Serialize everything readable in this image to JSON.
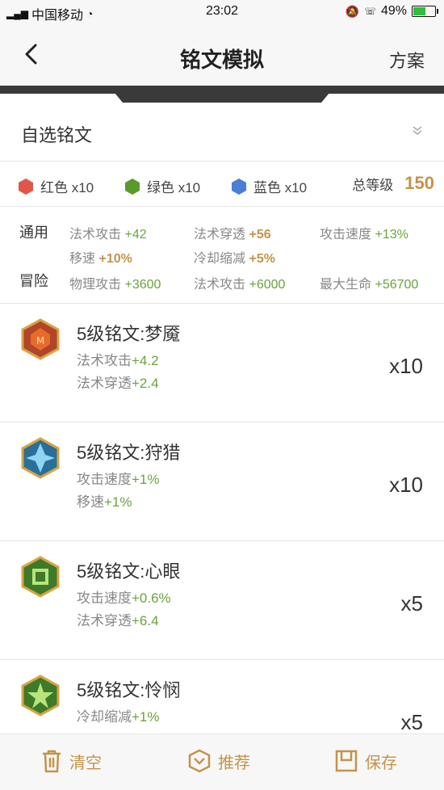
{
  "status": {
    "carrier": "中国移动",
    "time": "23:02",
    "battery": "49%"
  },
  "nav": {
    "title": "铭文模拟",
    "right_label": "方案"
  },
  "selector": {
    "label": "自选铭文"
  },
  "colors": {
    "red": {
      "label": "红色 x10",
      "color": "#e0574a"
    },
    "green": {
      "label": "绿色 x10",
      "color": "#5a9a2d"
    },
    "blue": {
      "label": "蓝色 x10",
      "color": "#4a7fd4"
    },
    "level_label": "总等级",
    "level_value": "150"
  },
  "stats": {
    "general_label": "通用",
    "adventure_label": "冒险",
    "general": [
      {
        "name": "法术攻击",
        "value": "+42"
      },
      {
        "name": "法术穿透",
        "value": "+56"
      },
      {
        "name": "攻击速度",
        "value": "+13%"
      },
      {
        "name": "移速",
        "value": "+10%"
      },
      {
        "name": "冷却缩减",
        "value": "+5%"
      }
    ],
    "adventure": [
      {
        "name": "物理攻击",
        "value": "+3600"
      },
      {
        "name": "法术攻击",
        "value": "+6000"
      },
      {
        "name": "最大生命",
        "value": "+56700"
      }
    ]
  },
  "runes": [
    {
      "name": "5级铭文:梦魇",
      "s1_name": "法术攻击",
      "s1_val": "+4.2",
      "s2_name": "法术穿透",
      "s2_val": "+2.4",
      "count": "x10",
      "icon": "red-rune-icon"
    },
    {
      "name": "5级铭文:狩猎",
      "s1_name": "攻击速度",
      "s1_val": "+1%",
      "s2_name": "移速",
      "s2_val": "+1%",
      "count": "x10",
      "icon": "blue-rune-icon"
    },
    {
      "name": "5级铭文:心眼",
      "s1_name": "攻击速度",
      "s1_val": "+0.6%",
      "s2_name": "法术穿透",
      "s2_val": "+6.4",
      "count": "x5",
      "icon": "green-rune-icon"
    },
    {
      "name": "5级铭文:怜悯",
      "s1_name": "冷却缩减",
      "s1_val": "+1%",
      "s2_name": "",
      "s2_val": "",
      "count": "x5",
      "icon": "green-rune-icon"
    }
  ],
  "bottom": {
    "clear": "清空",
    "recommend": "推荐",
    "save": "保存"
  },
  "accent": "#c4934a"
}
